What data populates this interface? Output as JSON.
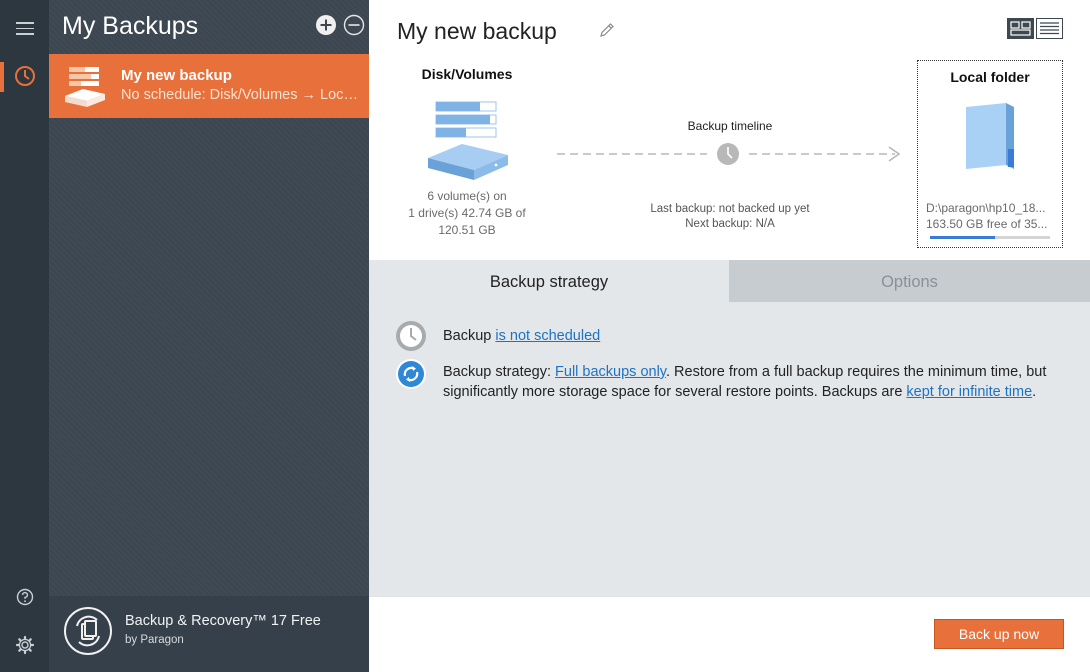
{
  "sidebar": {
    "title": "My Backups",
    "items": [
      {
        "name": "My new backup",
        "summary": "No schedule: Disk/Volumes → Local folder"
      }
    ],
    "product": "Backup & Recovery™ 17 Free",
    "vendor": "by Paragon"
  },
  "main": {
    "backup_name": "My new backup",
    "source": {
      "title": "Disk/Volumes",
      "line1": "6 volume(s) on",
      "line2": "1 drive(s) 42.74 GB of",
      "line3": "120.51 GB"
    },
    "timeline": {
      "title": "Backup timeline",
      "last": "Last backup: not backed up yet",
      "next": "Next backup: N/A"
    },
    "destination": {
      "title": "Local folder",
      "path": "D:\\paragon\\hp10_18...",
      "free": "163.50 GB free of 35...",
      "used_fraction": 0.54
    },
    "tabs": {
      "strategy": "Backup strategy",
      "options": "Options"
    },
    "schedule": {
      "prefix": "Backup ",
      "link": "is not scheduled"
    },
    "strategy": {
      "prefix": "Backup strategy: ",
      "link1": "Full backups only",
      "mid": ". Restore from a full backup requires the minimum time, but significantly more storage space for several restore points. Backups are ",
      "link2": "kept for infinite time",
      "suffix": "."
    },
    "backup_button": "Back up now"
  },
  "colors": {
    "accent": "#e8703a",
    "panel": "#3d4751",
    "rail": "#2d3740",
    "link": "#1e72c2",
    "disk_blue": "#7fb3e6"
  }
}
